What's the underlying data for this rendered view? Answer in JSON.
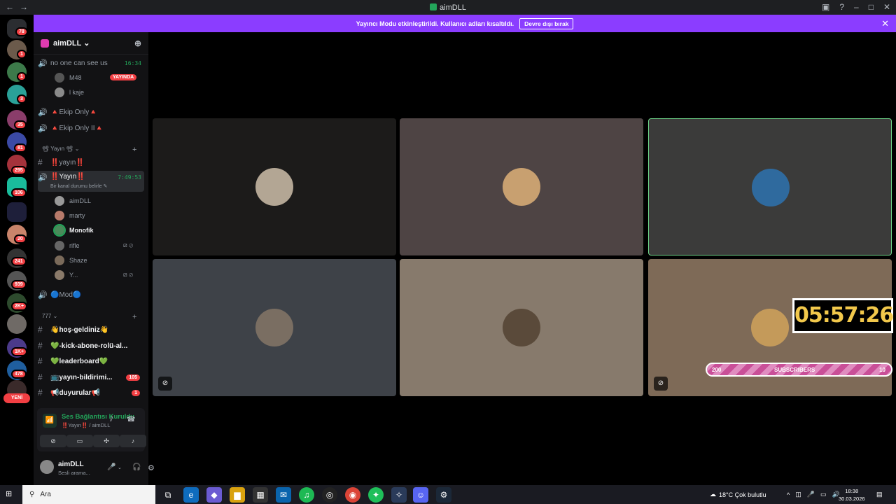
{
  "window": {
    "title": "aimDLL",
    "back": "←",
    "forward": "→"
  },
  "banner": {
    "text": "Yayıncı Modu etkinleştirildi. Kullanıcı adları kısaltıldı.",
    "button": "Devre dışı bırak",
    "close": "✕"
  },
  "servers": {
    "badges": [
      "78",
      "1",
      "1",
      "3",
      "35",
      "81",
      "295",
      "106",
      "20",
      "241",
      "939",
      "2K+",
      "1K+",
      "478"
    ],
    "new_label": "YENİ"
  },
  "guild": {
    "name": "aimDLL ⌄",
    "add": "⊕"
  },
  "voice_channels": [
    {
      "name": "no one can see us",
      "time": "16:34"
    },
    {
      "name": "🔺Ekip Only🔺"
    },
    {
      "name": "🔺Ekip Only II🔺"
    }
  ],
  "first_users": [
    {
      "name": "M48",
      "live": "YAYINDA"
    },
    {
      "name": "l kaje"
    }
  ],
  "category_yayin": "📽 Yayın 📽 ⌄",
  "yayin_text": "‼️yayın‼️",
  "active_voice": {
    "name": "‼️Yayın‼️",
    "time": "7:49:53",
    "status": "Bir kanal durumu belirle ✎"
  },
  "voice_users": [
    "aimDLL",
    "marty",
    "Monofik",
    "rifle",
    "Shaze",
    "Y..."
  ],
  "mod_channel": "🔵Mod🔵",
  "category_777": "777 ⌄",
  "text_channels": [
    {
      "name": "👋hoş-geldiniz👋"
    },
    {
      "name": "💚-kick-abone-rolü-al..."
    },
    {
      "name": "💚leaderboard💚"
    },
    {
      "name": "📺yayın-bildirimi...",
      "count": "105"
    },
    {
      "name": "📢duyurular📢",
      "count": "1"
    }
  ],
  "voice_panel": {
    "title": "Ses Bağlantısı Kuruldu",
    "subtitle": "‼️Yayın‼️ / aimDLL"
  },
  "user_panel": {
    "name": "aimDLL",
    "status": "Sesli arama..."
  },
  "overlay": {
    "timer": "05:57:26",
    "sub_left": "200",
    "sub_label": "SUBSCRIBERS",
    "sub_right": "10"
  },
  "taskbar": {
    "search": "Ara",
    "weather": "18°C  Çok bulutlu",
    "time": "18:38",
    "date": "30.03.2026"
  },
  "colors": {
    "accent": "#8b3dff",
    "online": "#23a55a",
    "danger": "#f23f43"
  }
}
